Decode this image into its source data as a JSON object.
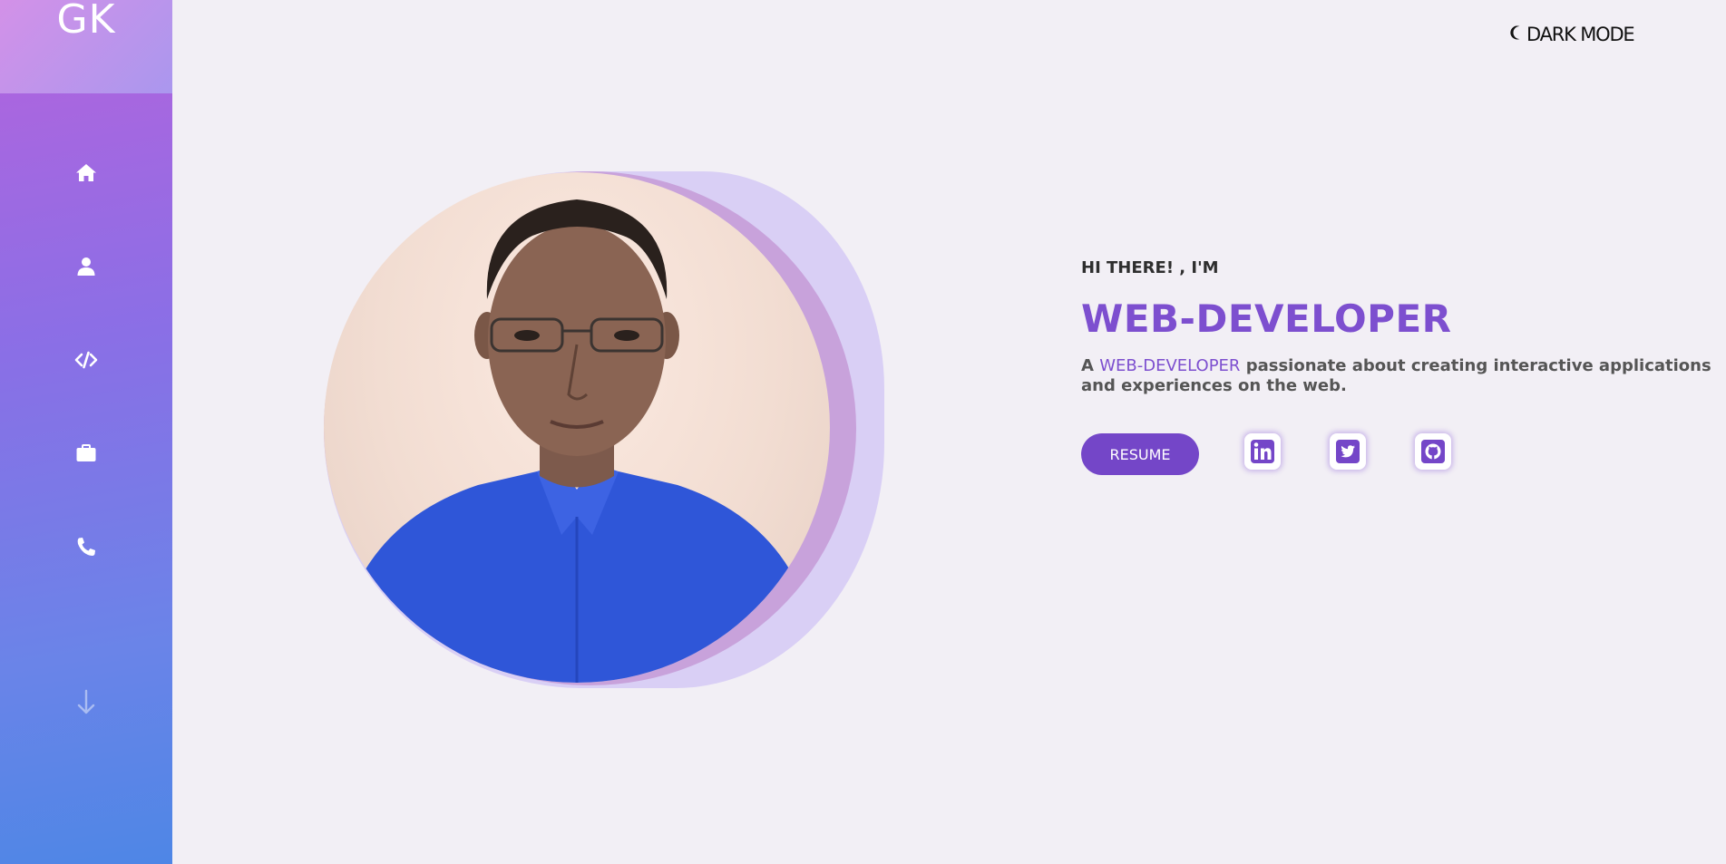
{
  "sidebar": {
    "logo": "GK",
    "nav": [
      {
        "icon": "home-icon"
      },
      {
        "icon": "user-icon"
      },
      {
        "icon": "code-icon"
      },
      {
        "icon": "briefcase-icon"
      },
      {
        "icon": "phone-icon"
      }
    ],
    "scroll_icon": "arrow-down-icon"
  },
  "header": {
    "dark_mode_label": "DARK MODE",
    "dark_mode_icon": "moon-icon"
  },
  "hero": {
    "greeting": "HI THERE! , I'M",
    "role": "WEB-DEVELOPER",
    "desc_prefix": "A ",
    "desc_highlight": "WEB-DEVELOPER",
    "desc_suffix": " passionate about creating interactive applications and experiences on the web.",
    "resume_label": "RESUME",
    "social": [
      {
        "icon": "linkedin-icon"
      },
      {
        "icon": "twitter-icon"
      },
      {
        "icon": "github-icon"
      }
    ]
  },
  "colors": {
    "accent": "#7d4fcf",
    "button": "#7446c8",
    "background": "#f2eff5"
  }
}
